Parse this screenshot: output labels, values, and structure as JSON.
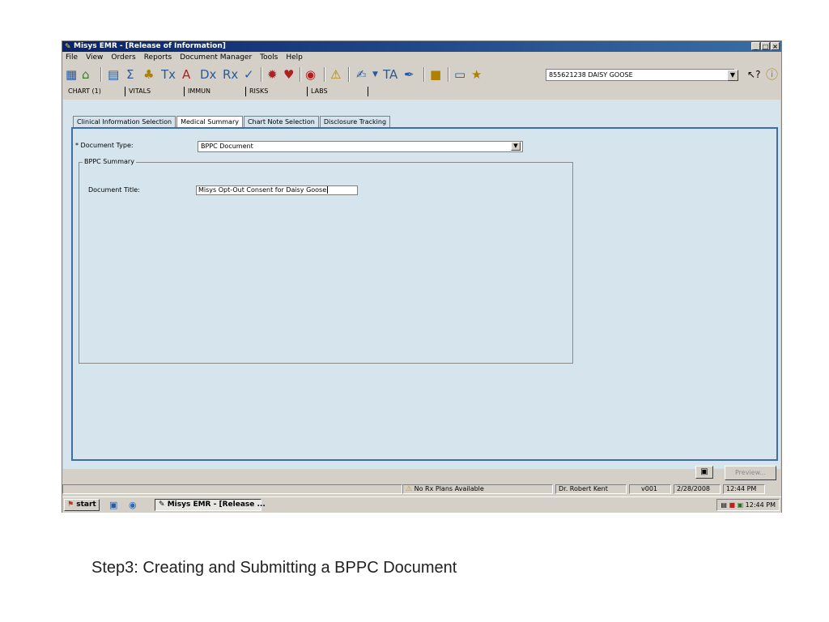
{
  "window": {
    "title": "Misys EMR - [Release of Information]",
    "min": "_",
    "max": "□",
    "close": "×"
  },
  "menu": [
    {
      "label": "File"
    },
    {
      "label": "View"
    },
    {
      "label": "Orders"
    },
    {
      "label": "Reports"
    },
    {
      "label": "Document Manager"
    },
    {
      "label": "Tools"
    },
    {
      "label": "Help"
    }
  ],
  "toolbar": {
    "tx": "Tx",
    "a": "A",
    "dx": "Dx",
    "rx": "Rx",
    "ta": "TA",
    "patient": "855621238    DAISY GOOSE",
    "help_glyph": "?"
  },
  "chart_tabs": [
    "CHART (1)",
    "VITALS",
    "IMMUN",
    "RISKS",
    "LABS"
  ],
  "sub_tabs": [
    "Clinical Information Selection",
    "Medical Summary",
    "Chart Note Selection",
    "Disclosure Tracking"
  ],
  "form": {
    "doc_type_label": "* Document Type:",
    "doc_type_value": "BPPC Document",
    "group_label": "BPPC Summary",
    "doc_title_label": "Document Title:",
    "doc_title_value": "Misys Opt-Out Consent for Daisy Goose"
  },
  "buttons": {
    "preview": "Preview..."
  },
  "status": {
    "rx_plans": "No Rx Plans Available",
    "doctor": "Dr. Robert Kent",
    "version": "v001",
    "date": "2/28/2008",
    "time": "12:44 PM"
  },
  "taskbar": {
    "start": "start",
    "task": "Misys EMR - [Release ...",
    "clock": "12:44 PM"
  },
  "caption": "Step3: Creating and Submitting a BPPC Document"
}
